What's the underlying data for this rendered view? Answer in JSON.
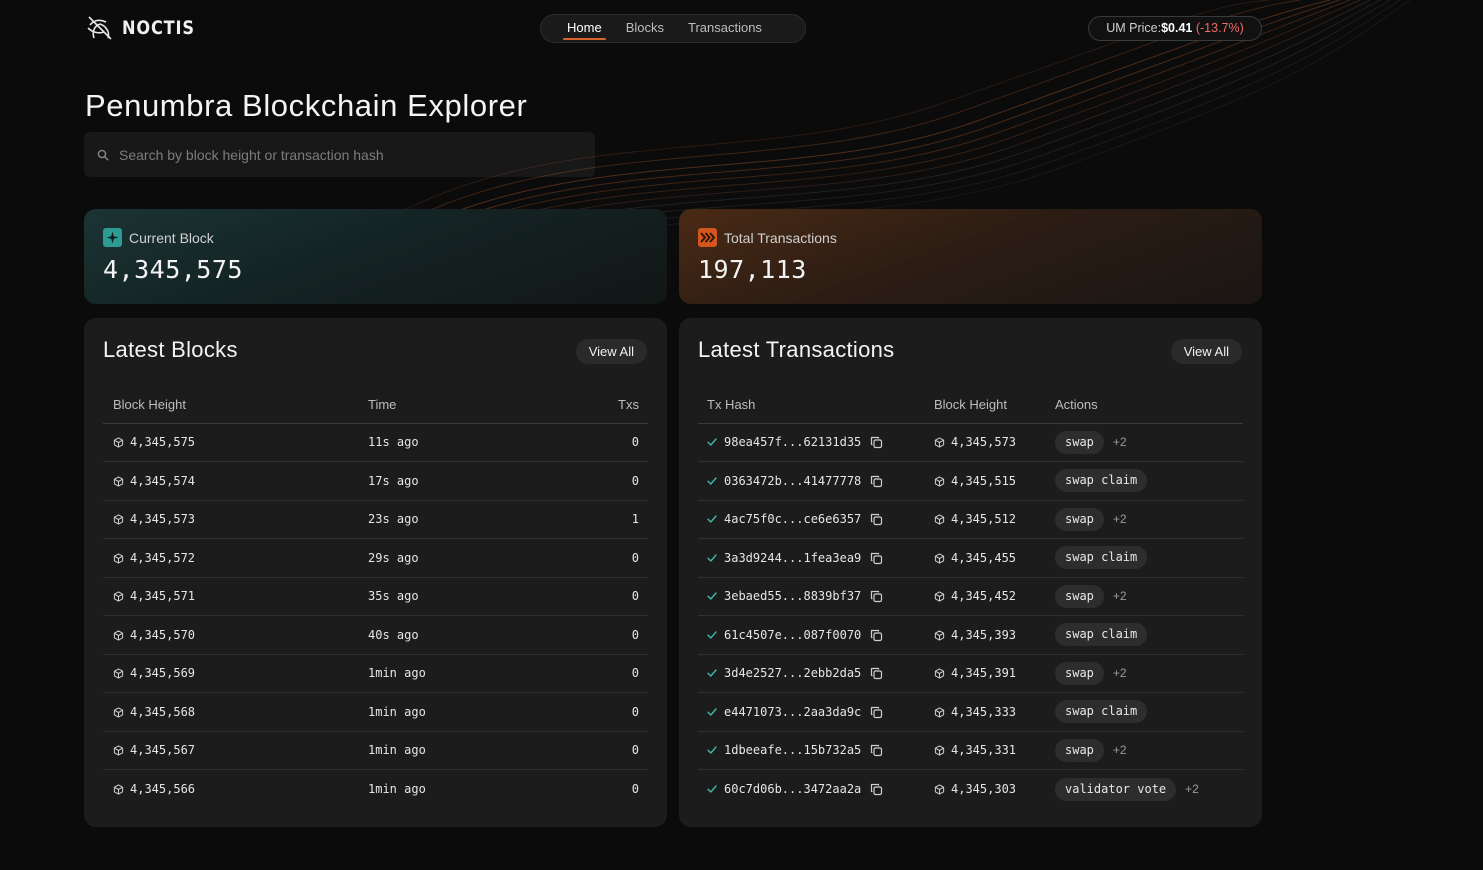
{
  "brand": {
    "name": "NOCTIS"
  },
  "nav": {
    "items": [
      "Home",
      "Blocks",
      "Transactions"
    ],
    "active": "Home"
  },
  "price": {
    "label": "UM Price:",
    "value": "$0.41",
    "change": "(-13.7%)"
  },
  "page_title": "Penumbra Blockchain Explorer",
  "search": {
    "placeholder": "Search by block height or transaction hash"
  },
  "stats": {
    "current_block": {
      "label": "Current Block",
      "value": "4,345,575"
    },
    "total_transactions": {
      "label": "Total Transactions",
      "value": "197,113"
    }
  },
  "latest_blocks": {
    "title": "Latest Blocks",
    "view_all": "View All",
    "columns": [
      "Block Height",
      "Time",
      "Txs"
    ],
    "rows": [
      {
        "height": "4,345,575",
        "time": "11s ago",
        "txs": "0"
      },
      {
        "height": "4,345,574",
        "time": "17s ago",
        "txs": "0"
      },
      {
        "height": "4,345,573",
        "time": "23s ago",
        "txs": "1"
      },
      {
        "height": "4,345,572",
        "time": "29s ago",
        "txs": "0"
      },
      {
        "height": "4,345,571",
        "time": "35s ago",
        "txs": "0"
      },
      {
        "height": "4,345,570",
        "time": "40s ago",
        "txs": "0"
      },
      {
        "height": "4,345,569",
        "time": "1min ago",
        "txs": "0"
      },
      {
        "height": "4,345,568",
        "time": "1min ago",
        "txs": "0"
      },
      {
        "height": "4,345,567",
        "time": "1min ago",
        "txs": "0"
      },
      {
        "height": "4,345,566",
        "time": "1min ago",
        "txs": "0"
      }
    ]
  },
  "latest_transactions": {
    "title": "Latest Transactions",
    "view_all": "View All",
    "columns": [
      "Tx Hash",
      "Block Height",
      "Actions"
    ],
    "rows": [
      {
        "hash": "98ea457f...62131d35",
        "height": "4,345,573",
        "action": "swap",
        "more": "+2"
      },
      {
        "hash": "0363472b...41477778",
        "height": "4,345,515",
        "action": "swap claim",
        "more": ""
      },
      {
        "hash": "4ac75f0c...ce6e6357",
        "height": "4,345,512",
        "action": "swap",
        "more": "+2"
      },
      {
        "hash": "3a3d9244...1fea3ea9",
        "height": "4,345,455",
        "action": "swap claim",
        "more": ""
      },
      {
        "hash": "3ebaed55...8839bf37",
        "height": "4,345,452",
        "action": "swap",
        "more": "+2"
      },
      {
        "hash": "61c4507e...087f0070",
        "height": "4,345,393",
        "action": "swap claim",
        "more": ""
      },
      {
        "hash": "3d4e2527...2ebb2da5",
        "height": "4,345,391",
        "action": "swap",
        "more": "+2"
      },
      {
        "hash": "e4471073...2aa3da9c",
        "height": "4,345,333",
        "action": "swap claim",
        "more": ""
      },
      {
        "hash": "1dbeeafe...15b732a5",
        "height": "4,345,331",
        "action": "swap",
        "more": "+2"
      },
      {
        "hash": "60c7d06b...3472aa2a",
        "height": "4,345,303",
        "action": "validator vote",
        "more": "+2"
      }
    ]
  },
  "colors": {
    "accent": "#d8662a",
    "negative": "#f06a6a",
    "teal": "#2c9b94",
    "orange": "#d4561d"
  },
  "icons": [
    "noctis-logo-icon",
    "search-icon",
    "sparkle-icon",
    "chevrons-right-icon",
    "cube-icon",
    "check-icon",
    "copy-icon"
  ]
}
